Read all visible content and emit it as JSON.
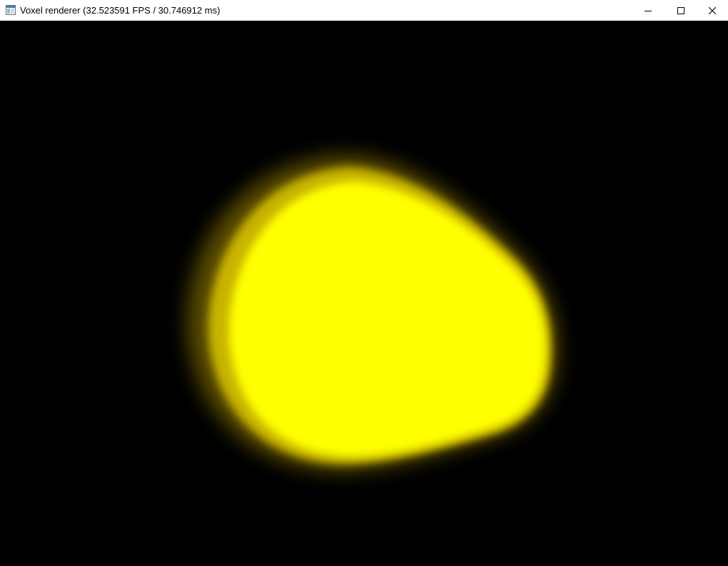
{
  "window": {
    "title": "Voxel renderer (32.523591 FPS / 30.746912 ms)",
    "icon": "app-window-icon"
  },
  "caption_buttons": {
    "minimize": "minimize-icon",
    "maximize": "maximize-icon",
    "close": "close-icon"
  },
  "scene": {
    "background_color": "#000000",
    "object_color": "#ffff00",
    "object_icon": "voxel-blob"
  }
}
